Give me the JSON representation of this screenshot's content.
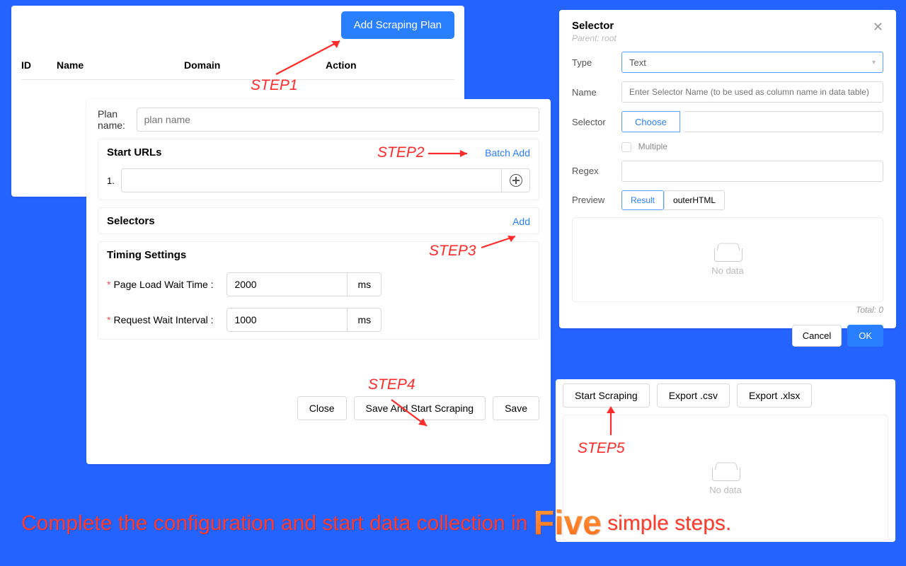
{
  "planlist": {
    "add_btn": "Add Scraping Plan",
    "cols": {
      "id": "ID",
      "name": "Name",
      "domain": "Domain",
      "action": "Action"
    }
  },
  "steps": {
    "s1": "STEP1",
    "s2": "STEP2",
    "s3": "STEP3",
    "s4": "STEP4",
    "s5": "STEP5"
  },
  "planform": {
    "plan_name_label": "Plan name:",
    "plan_name_placeholder": "plan name",
    "start_urls_title": "Start URLs",
    "batch_add": "Batch Add",
    "url_index": "1.",
    "selectors_title": "Selectors",
    "selectors_add": "Add",
    "timing_title": "Timing Settings",
    "page_load_label": "Page Load Wait Time :",
    "page_load_value": "2000",
    "request_wait_label": "Request Wait Interval :",
    "request_wait_value": "1000",
    "unit": "ms",
    "close": "Close",
    "save_start": "Save And Start Scraping",
    "save": "Save"
  },
  "selector": {
    "title": "Selector",
    "parent": "Parent: root",
    "type_label": "Type",
    "type_value": "Text",
    "name_label": "Name",
    "name_placeholder": "Enter Selector Name (to be used as column name in data table)",
    "selector_label": "Selector",
    "choose": "Choose",
    "multiple": "Multiple",
    "regex_label": "Regex",
    "preview_label": "Preview",
    "result": "Result",
    "outerhtml": "outerHTML",
    "nodata": "No data",
    "total": "Total: 0",
    "cancel": "Cancel",
    "ok": "OK"
  },
  "results": {
    "start": "Start Scraping",
    "csv": "Export .csv",
    "xlsx": "Export .xlsx",
    "nodata": "No data"
  },
  "tagline": {
    "pre": "Complete the configuration and start data collection in ",
    "five": "Five",
    "post": " simple steps."
  }
}
